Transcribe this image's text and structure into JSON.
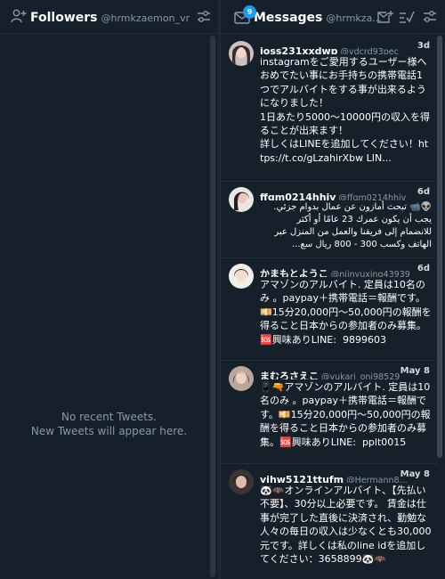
{
  "followers": {
    "column_number": "5",
    "title": "Followers",
    "handle": "@hrmkzaemon_vr",
    "empty_line1": "No recent Tweets.",
    "empty_line2": "New Tweets will appear here."
  },
  "messages": {
    "column_number": "6",
    "badge": "9",
    "title": "Messages",
    "handle": "@hrmkza...",
    "items": [
      {
        "name": "joss231xxdwp",
        "handle": "@vdcrd93pec",
        "time": "3d",
        "text": "instagramをご愛用するユーザー様へ\nおめでたい事にお手持ちの携帯電話1つでアルバイトをする事が出来るようになりました！\n1日あたり5000〜10000円の収入を得ることが出来ます！\n詳しくはLINEを追加してください！https://t.co/gLzahirXbw LIN..."
      },
      {
        "name": "ffgm0214hhjv",
        "handle": "@ffgm0214hhjv",
        "time": "6d",
        "text": "👽📹 تبحث أمازون عن عمال بدوام جزئي.\nيجب أن يكون عمرك 23 عامًا أو أكثر\nللانضمام إلى فريقنا والعمل من المنزل عبر\nالهاتف وكسب 300 - 800 ريال سع..."
      },
      {
        "name": "かまもとようこ",
        "handle": "@njjnyuxing43939",
        "time": "6d",
        "text": "アマゾンのアルバイト. 定員は10名のみ 。paypay＋携帯電話＝報酬です。💴15分20,000円〜50,000円の報酬を得ること日本からの参加者のみ募集。🆘興味ありLINE:  9899603"
      },
      {
        "name": "まむろさえこ",
        "handle": "@yukari_oni98529",
        "time": "May 8",
        "text": "📱🔫アマゾンのアルバイト. 定員は10名のみ 。paypay＋携帯電話＝報酬です。💴15分20,000円〜50,000円の報酬を得ること日本からの参加者のみ募集。🆘興味ありLINE:  pplt0015"
      },
      {
        "name": "vjhw5121ttufm",
        "handle": "@Hermann8...",
        "time": "May 8",
        "text": "🐼🦇オンラインアルバイト、【先払い不要】、30分以上必要です。 賃金は仕事が完了した直後に決済され、勤勉な人々の毎日の収入は少なくとも30,000元です。詳しくは私のline idを追加してください：3658899🐼🦇"
      }
    ]
  },
  "colors": {
    "background": "#15202b",
    "divider": "#22303c",
    "muted_text": "#8899a6",
    "accent": "#1d9bf0",
    "icon": "#8899a6"
  },
  "icons": {
    "followers": "person-add-icon",
    "filter": "sliders-icon",
    "messages": "envelope-icon",
    "compose": "new-message-icon",
    "mark_read": "check-list-icon"
  }
}
